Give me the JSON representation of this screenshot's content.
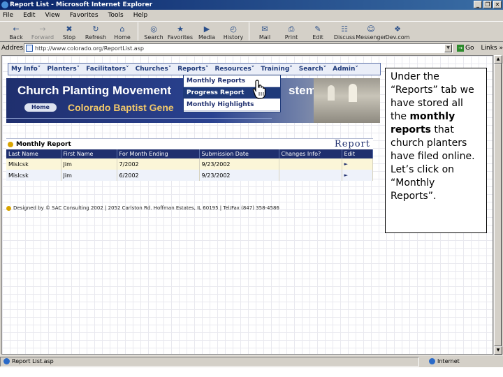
{
  "window": {
    "title": "Report List - Microsoft Internet Explorer",
    "controls": [
      "_",
      "❐",
      "✕"
    ]
  },
  "menu": [
    "File",
    "Edit",
    "View",
    "Favorites",
    "Tools",
    "Help"
  ],
  "toolbar": {
    "buttons": [
      {
        "label": "Back",
        "icon": "←"
      },
      {
        "label": "Forward",
        "icon": "→"
      },
      {
        "label": "Stop",
        "icon": "✖"
      },
      {
        "label": "Refresh",
        "icon": "↻"
      },
      {
        "label": "Home",
        "icon": "⌂"
      },
      {
        "label": "Search",
        "icon": "◎"
      },
      {
        "label": "Favorites",
        "icon": "★"
      },
      {
        "label": "Media",
        "icon": "▶"
      },
      {
        "label": "History",
        "icon": "◴"
      },
      {
        "label": "Mail",
        "icon": "✉"
      },
      {
        "label": "Print",
        "icon": "⎙"
      },
      {
        "label": "Edit",
        "icon": "✎"
      },
      {
        "label": "Discuss",
        "icon": "☷"
      },
      {
        "label": "Messenger",
        "icon": "☺"
      },
      {
        "label": "Dev.com",
        "icon": "❖"
      }
    ]
  },
  "address": {
    "label": "Address",
    "url": "http://www.colorado.org/ReportList.asp",
    "go": "Go",
    "links": "Links »"
  },
  "site": {
    "nav": [
      "My Info˅",
      "Planters˅",
      "Facilitators˅",
      "Churches˅",
      "Reports˅",
      "Resources˅",
      "Training˅",
      "Search˅",
      "Admin˅"
    ],
    "banner_title": "Church Planting Movement",
    "banner_title_tail": "stem",
    "home": "Home",
    "banner_sub": "Colorado Baptist Gene",
    "dropdown": [
      "Monthly Reports",
      "Progress Report",
      "Monthly Highlights"
    ],
    "report_heading": "Monthly Report",
    "report_badge": "Report",
    "table": {
      "headers": [
        "Last Name",
        "First Name",
        "For Month Ending",
        "Submission Date",
        "Changes Info?",
        "Edit"
      ],
      "rows": [
        [
          "Mislcsk",
          "Jim",
          "7/2002",
          "9/23/2002",
          "",
          "►"
        ],
        [
          "Mislcsk",
          "Jim",
          "6/2002",
          "9/23/2002",
          "",
          "►"
        ]
      ]
    },
    "footer": "Designed by © SAC Consulting 2002 | 2052 Carlston Rd. Hoffman Estates, IL 60195 | Tel/Fax (847) 358-4586"
  },
  "status": {
    "text": "Report List.asp",
    "zone": "Internet"
  },
  "callout": {
    "before": "Under the “Reports” tab we have stored all the ",
    "bold": "monthly reports",
    "after": " that church planters have filed online.  Let’s click on “Monthly Reports”."
  }
}
